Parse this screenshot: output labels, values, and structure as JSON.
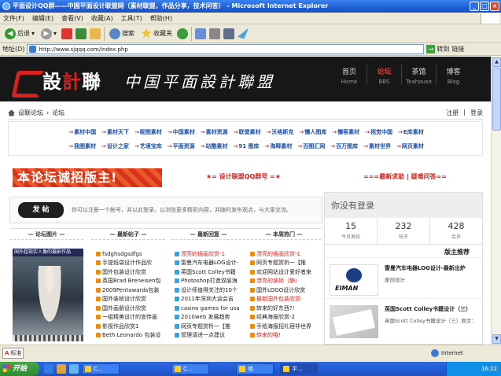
{
  "window": {
    "title": "平面设计QQ群——中国平面设计联盟网（素材联盟，作品分享，技术问答） - Microsoft Internet Explorer"
  },
  "menu": [
    "文件(F)",
    "编辑(E)",
    "查看(V)",
    "收藏(A)",
    "工具(T)",
    "帮助(H)"
  ],
  "toolbar": {
    "back": "后退",
    "search": "搜索",
    "favorites": "收藏夹"
  },
  "address": {
    "label": "地址(D)",
    "url": "http://www.sjqqq.com/index.php",
    "go": "转到",
    "links": "链接"
  },
  "site": {
    "logo_a": "設",
    "logo_b": "計",
    "logo_c": "聯",
    "slogan": "中国平面設計聯盟",
    "nav": [
      {
        "cn": "首页",
        "en": "Home"
      },
      {
        "cn": "论坛",
        "en": "BBS"
      },
      {
        "cn": "茶馆",
        "en": "Teahouse"
      },
      {
        "cn": "博客",
        "en": "Blog"
      }
    ],
    "breadcrumb_a": "设联论坛",
    "breadcrumb_b": "论坛",
    "register": "注册",
    "login": "登录"
  },
  "links_row1": [
    "素材中国",
    "素材天下",
    "昵图素材",
    "中国素材",
    "素材资源",
    "联盟素材",
    "沃格斯克",
    "懒人图库",
    "懒客素材",
    "视觉中国",
    "E库素材"
  ],
  "links_row2": [
    "我图素材",
    "设计之家",
    "艺境宝库",
    "平面资源",
    "站酷素材",
    "91 图库",
    "淘释素材",
    "百图汇网",
    "百万图库",
    "素材世界",
    "网页素材"
  ],
  "promo": "本论坛诚招版主!",
  "qq": "★= 设计联盟QQ群号 =★",
  "need": "===最新求助 | 疑难问答==",
  "login_box": {
    "button": "发 帖",
    "text": "你可以注册一个帐号，并以此登录，以浏览更多精彩内容，并随时发布观点，与大家交流。"
  },
  "cols": {
    "pic": "论坛图片",
    "new": "最新帖子",
    "reply": "最新回复",
    "hot": "本周热门"
  },
  "feature_caption": "国外超现实人像的摄影作品",
  "new_posts": [
    "fsdghsdgsdfgs",
    "手提纸袋设计作品欣",
    "国外包装设计欣赏",
    "英国Brad Breneisen包",
    "2009Pentawards包装",
    "国外装帧设计欣赏",
    "国外画册设计欣赏",
    "一组精美设计的宣传画",
    "影视作品欣赏1",
    "Beth Leonardo 包装设"
  ],
  "new_replies": [
    "漂亮的插画欣赏-1",
    "雷曼汽车电器LOG设计-",
    "英国Scott Colley书籍",
    "Photoshop打造双层海",
    "设计师值得关注的10个",
    "2011年深圳大运会吉",
    "casino games for usa",
    "2010web 发展趋势",
    "网页专题赏析一【推",
    "管理请进一点建议"
  ],
  "hot_posts": [
    "漂亮的插画欣赏-1",
    "网页专题赏析一【推",
    "欢迎网站设计爱好者来",
    "漂亮的装帧（静）",
    "国外LOGO设计欣赏",
    "最新国外包装欣赏-",
    "转来的好东西?!",
    "经典海报欣赏-2",
    "手绘海报招礼宿非世界",
    "转来的哦!"
  ],
  "sidebar": {
    "guest": "你没有登录",
    "stats": [
      {
        "n": "15",
        "l": "今日发帖"
      },
      {
        "n": "232",
        "l": "帖子"
      },
      {
        "n": "428",
        "l": "会员"
      }
    ],
    "rec": "版主推荐",
    "cards": [
      {
        "title": "雷曼汽车电器LOG设计-最新出炉",
        "sub": "原创设计",
        "logo": "EIMAN"
      },
      {
        "title": "英国Scott Colley书籍设计（三）",
        "sub": "英国Scott Colley书籍设计（三）原文："
      }
    ]
  },
  "status": {
    "ime": "标准",
    "zone": "Internet"
  },
  "taskbar": {
    "start": "开始",
    "tasks": [
      "C...",
      "C...",
      "地",
      "平..."
    ],
    "clock": "16:22"
  }
}
